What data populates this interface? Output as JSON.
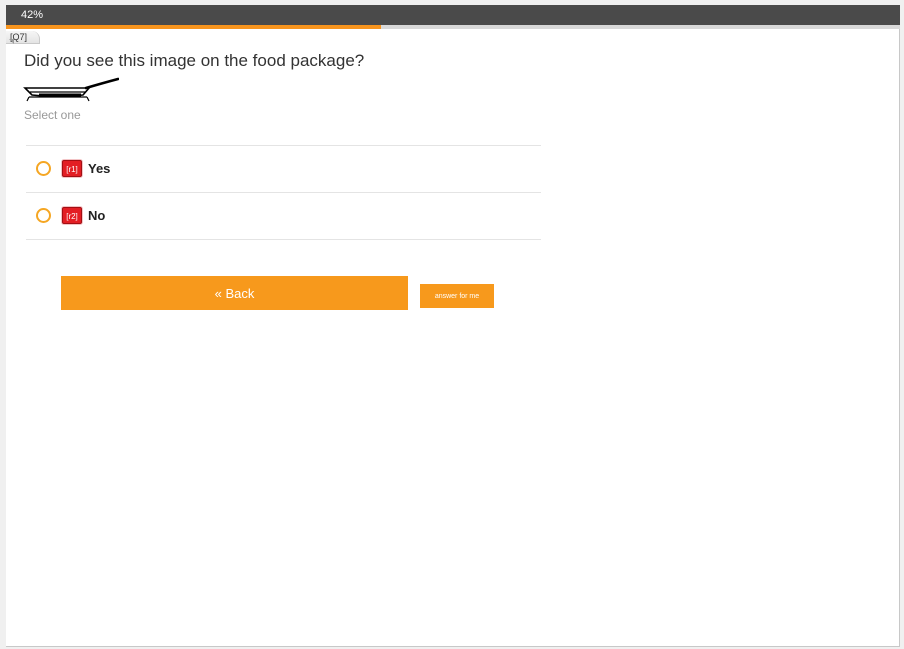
{
  "progress": {
    "label": "42%",
    "fraction": 0.42,
    "fill_color": "#f7941d"
  },
  "question": {
    "id_label": "[Q7]",
    "text": "Did you see this image on the food package?",
    "image_icon": "frying-pan-icon",
    "instruction": "Select one"
  },
  "answers": [
    {
      "code": "[r1]",
      "label": "Yes"
    },
    {
      "code": "[r2]",
      "label": "No"
    }
  ],
  "buttons": {
    "back_label": "« Back",
    "answer_for_me_label": "answer for me"
  },
  "colors": {
    "accent": "#f7991c",
    "radio_border": "#f5a623",
    "badge": "#e31e24"
  }
}
